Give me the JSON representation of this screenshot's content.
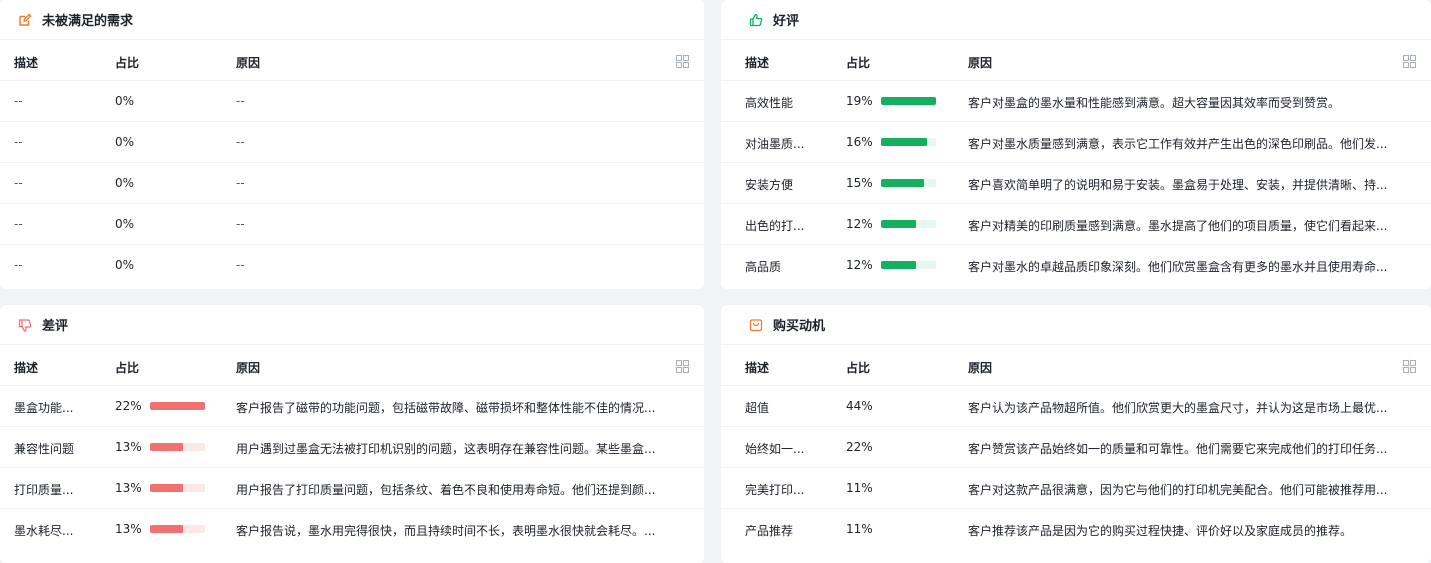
{
  "columns": {
    "desc": "描述",
    "pct": "占比",
    "reason": "原因"
  },
  "colors": {
    "good": "#13b05f",
    "bad": "#f0716f",
    "track": "#fde8e7",
    "track_good": "#e7f7ee"
  },
  "unmet": {
    "title": "未被满足的需求",
    "icon": "edit-icon",
    "rows": [
      {
        "desc": "--",
        "pct": "0%",
        "reason": "--"
      },
      {
        "desc": "--",
        "pct": "0%",
        "reason": "--"
      },
      {
        "desc": "--",
        "pct": "0%",
        "reason": "--"
      },
      {
        "desc": "--",
        "pct": "0%",
        "reason": "--"
      },
      {
        "desc": "--",
        "pct": "0%",
        "reason": "--"
      }
    ]
  },
  "good": {
    "title": "好评",
    "icon": "thumbs-up-icon",
    "rows": [
      {
        "desc": "高效性能",
        "pct": "19%",
        "value": 19,
        "reason": "客户对墨盒的墨水量和性能感到满意。超大容量因其效率而受到赞赏。"
      },
      {
        "desc": "对油墨质...",
        "pct": "16%",
        "value": 16,
        "reason": "客户对墨水质量感到满意，表示它工作有效并产生出色的深色印刷品。他们发..."
      },
      {
        "desc": "安装方便",
        "pct": "15%",
        "value": 15,
        "reason": "客户喜欢简单明了的说明和易于安装。墨盒易于处理、安装，并提供清晰、持..."
      },
      {
        "desc": "出色的打...",
        "pct": "12%",
        "value": 12,
        "reason": "客户对精美的印刷质量感到满意。墨水提高了他们的项目质量，使它们看起来..."
      },
      {
        "desc": "高品质",
        "pct": "12%",
        "value": 12,
        "reason": "客户对墨水的卓越品质印象深刻。他们欣赏墨盒含有更多的墨水并且使用寿命..."
      }
    ]
  },
  "bad": {
    "title": "差评",
    "icon": "thumbs-down-icon",
    "rows": [
      {
        "desc": "墨盒功能...",
        "pct": "22%",
        "value": 22,
        "reason": "客户报告了磁带的功能问题，包括磁带故障、磁带损坏和整体性能不佳的情况..."
      },
      {
        "desc": "兼容性问题",
        "pct": "13%",
        "value": 13,
        "reason": "用户遇到过墨盒无法被打印机识别的问题，这表明存在兼容性问题。某些墨盒..."
      },
      {
        "desc": "打印质量...",
        "pct": "13%",
        "value": 13,
        "reason": "用户报告了打印质量问题，包括条纹、着色不良和使用寿命短。他们还提到颜..."
      },
      {
        "desc": "墨水耗尽...",
        "pct": "13%",
        "value": 13,
        "reason": "客户报告说，墨水用完得很快，而且持续时间不长，表明墨水很快就会耗尽。..."
      }
    ]
  },
  "motive": {
    "title": "购买动机",
    "icon": "shopping-bag-icon",
    "rows": [
      {
        "desc": "超值",
        "pct": "44%",
        "reason": "客户认为该产品物超所值。他们欣赏更大的墨盒尺寸，并认为这是市场上最优..."
      },
      {
        "desc": "始终如一...",
        "pct": "22%",
        "reason": "客户赞赏该产品始终如一的质量和可靠性。他们需要它来完成他们的打印任务..."
      },
      {
        "desc": "完美打印...",
        "pct": "11%",
        "reason": "客户对这款产品很满意，因为它与他们的打印机完美配合。他们可能被推荐用..."
      },
      {
        "desc": "产品推荐",
        "pct": "11%",
        "reason": "客户推荐该产品是因为它的购买过程快捷、评价好以及家庭成员的推荐。"
      }
    ]
  }
}
